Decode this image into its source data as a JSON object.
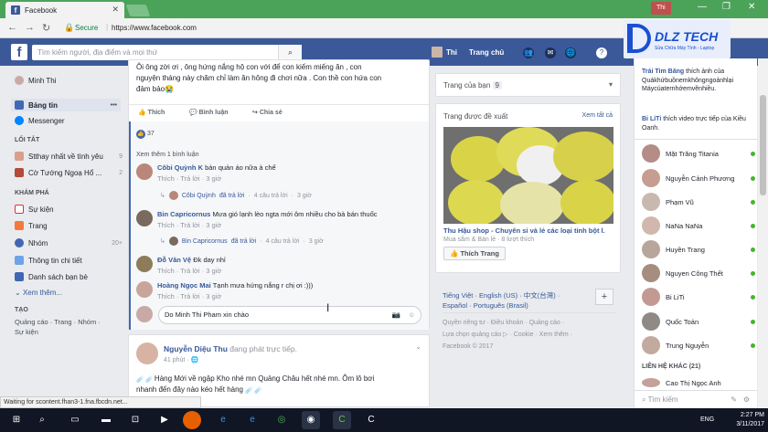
{
  "browser": {
    "tab_title": "Facebook",
    "secure_label": "Secure",
    "url": "https://www.facebook.com",
    "window_user": "Thi"
  },
  "topbar": {
    "search_placeholder": "Tìm kiếm người, địa điểm và mọi thứ",
    "user_name": "Thi",
    "home_label": "Trang chủ"
  },
  "watermark": {
    "brand": "DLZ TECH",
    "tagline": "Sửa Chữa Máy Tính - Laptop"
  },
  "leftnav": {
    "profile": "Minh Thi",
    "items": [
      {
        "label": "Bảng tin",
        "icon": "newsfeed-icon"
      },
      {
        "label": "Messenger",
        "icon": "messenger-icon"
      }
    ],
    "shortcuts_title": "LỐI TẮT",
    "shortcuts": [
      {
        "label": "Stthay nhất về tình yêu",
        "count": "9"
      },
      {
        "label": "Cờ Tướng Ngoạ Hổ ...",
        "count": "2"
      }
    ],
    "explore_title": "KHÁM PHÁ",
    "explore": [
      {
        "label": "Sự kiện",
        "count": ""
      },
      {
        "label": "Trang",
        "count": ""
      },
      {
        "label": "Nhóm",
        "count": "20+"
      },
      {
        "label": "Thông tin chi tiết",
        "count": ""
      },
      {
        "label": "Danh sách bạn bè",
        "count": ""
      }
    ],
    "see_more": "Xem thêm...",
    "create_title": "TẠO",
    "create_links": "Quảng cáo · Trang · Nhóm ·",
    "create_links2": "Sự kiện"
  },
  "post1": {
    "text_line1": "Ôi ông zời ơi , ông hứng nắng hộ con với để con kiếm miếng ăn , con",
    "text_line2": "nguyện tháng này chăm chỉ làm ăn hông đi chơi nữa . Con thề con hứa con",
    "text_line3": "đảm bảo😭",
    "like": "Thích",
    "comment": "Bình luận",
    "share": "Chia sẻ",
    "reactions": "37",
    "more_comments": "Xem thêm 1 bình luận",
    "comments": [
      {
        "name": "Côbi Quỳnh K",
        "text": "bản quản áo nữa à chế",
        "like": "Thích",
        "reply": "Trả lời",
        "time": "3 giờ",
        "sub": {
          "name": "Côbi Quỳnh",
          "text": "đã trả lời",
          "count": "4 câu trả lời",
          "time": "3 giờ"
        }
      },
      {
        "name": "Bin Capricornus",
        "text": "Mưa gió lạnh lèo ngta mới ôm nhiều cho bà bán thuốc",
        "like": "Thích",
        "reply": "Trả lời",
        "time": "3 giờ",
        "sub": {
          "name": "Bin Capricornus",
          "text": "đã trả lời",
          "count": "4 câu trả lời",
          "time": "3 giờ"
        }
      },
      {
        "name": "Đỗ Văn Vệ",
        "text": "Đk day nhỉ",
        "like": "Thích",
        "reply": "Trả lời",
        "time": "3 giờ"
      },
      {
        "name": "Hoàng Ngọc Mai",
        "text": "Tạnh mưa hứng nắng r chị ơi :)))",
        "like": "Thích",
        "reply": "Trả lời",
        "time": "3 giờ"
      }
    ],
    "input_text": "Do Minh Thi Pham xin chào"
  },
  "post2": {
    "author": "Nguyễn Diệu Thu",
    "action": "đang phát trực tiếp.",
    "time": "41 phút",
    "text1": "☄️☄️Hàng Mới về ngập Kho nhé mn Quảng Châu hết nhé mn. Ôm lô bơi",
    "text2": "nhanh đến đây nào kéo hết hàng ☄️☄️"
  },
  "middle": {
    "your_pages": "Trang của bạn",
    "your_pages_count": "9",
    "suggest_title": "Trang được đề xuất",
    "see_all": "Xem tất cả",
    "suggest_name": "Thu Hậu shop - Chuyên sỉ và lẻ các loại tinh bột l.",
    "suggest_cat": "Mua sắm & Bán lẻ · 8 lượt thích",
    "like_page": "Thích Trang",
    "lang_line1": "Tiếng Việt · English (US) · 中文(台灣) ·",
    "lang_line2": "Español · Português (Brasil)",
    "footer1": "Quyền riêng tư · Điều khoản · Quảng cáo ·",
    "footer2": "Lựa chọn quảng cáo ▷ · Cookie · Xem thêm ·",
    "copyright": "Facebook © 2017"
  },
  "rightbar": {
    "ticker": [
      {
        "name": "Trái Tim Băng",
        "text": "thích ảnh của Quákhứbuồnemkhôngngoảnhlại Máycúaternhớemvềnhiều."
      },
      {
        "name": "Bi LiTi",
        "text": "thích video trực tiếp của Kiều Oanh."
      }
    ],
    "contacts": [
      "Mặt Trăng Titania",
      "Nguyễn Cảnh Phương",
      "Phạm Vũ",
      "NaNa NaNa",
      "Huyền Trang",
      "Nguyen Công Thết",
      "Bi LiTi",
      "Quốc Toản",
      "Trung Nguyễn"
    ],
    "other_title": "LIÊN HỆ KHÁC (21)",
    "other_first": "Cao Thị Ngọc Anh",
    "search_placeholder": "Tìm kiếm"
  },
  "status_text": "Waiting for scontent.fhan3-1.fna.fbcdn.net...",
  "taskbar": {
    "lang": "ENG",
    "time": "2:27 PM",
    "date": "3/11/2017"
  }
}
